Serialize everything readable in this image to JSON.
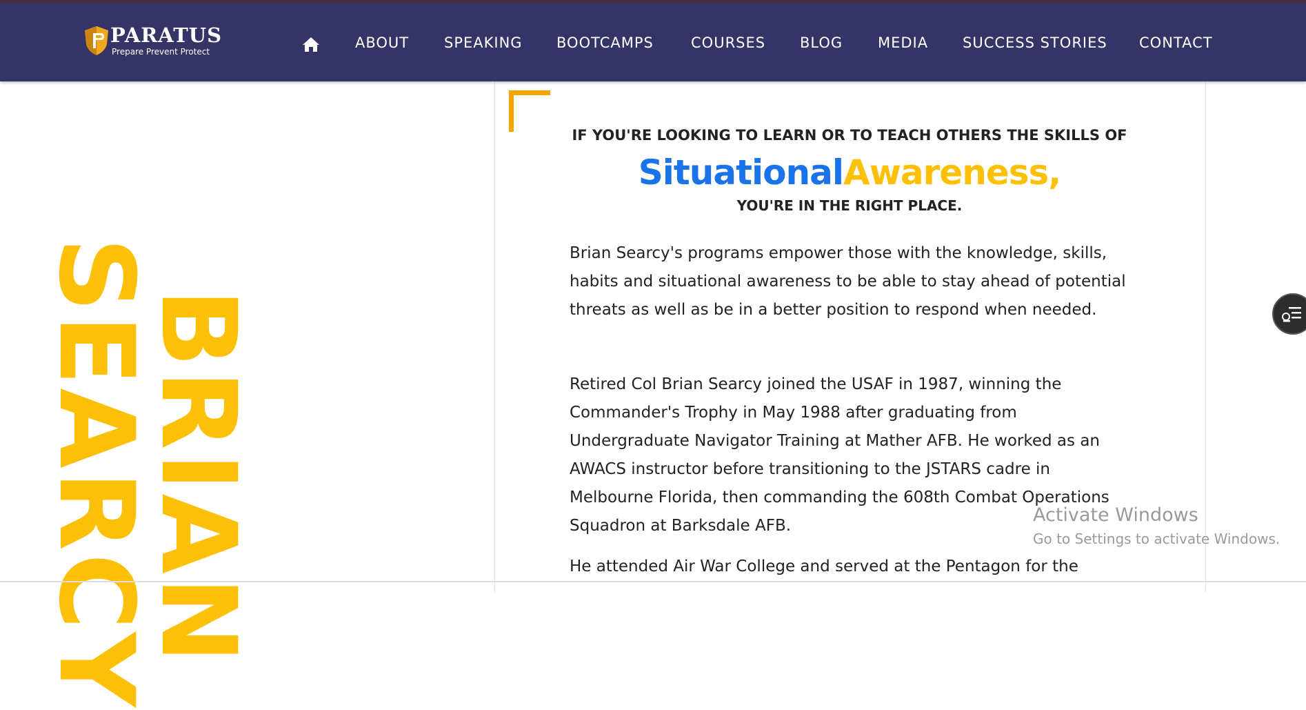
{
  "brand": {
    "name": "PARATUS",
    "tagline": "Prepare Prevent Protect",
    "shield_color": "#f0a91c"
  },
  "header": {
    "background": "#353467",
    "nav": [
      "ABOUT",
      "SPEAKING",
      "BOOTCAMPS",
      "COURSES",
      "BLOG",
      "MEDIA",
      "SUCCESS STORIES",
      "CONTACT"
    ],
    "home_icon": "home-icon"
  },
  "hero": {
    "first_name": "BRIAN",
    "last_name": "SEARCY",
    "accent_color": "#fbc007"
  },
  "intro": {
    "line1": "IF YOU'RE LOOKING TO LEARN OR TO TEACH OTHERS THE SKILLS OF",
    "headline_part1": "Situational",
    "headline_part2": "Awareness,",
    "line3": "YOU'RE IN THE RIGHT PLACE.",
    "blue": "#1a73e8",
    "gold": "#fbc007"
  },
  "body": {
    "p1": "Brian Searcy's programs empower those with the knowledge, skills, habits and situational awareness to be able to stay ahead of potential threats as well as be in a better position to respond when needed.",
    "p2": "Retired Col Brian Searcy joined the USAF in 1987, winning the Commander's Trophy in May 1988 after graduating from Undergraduate Navigator Training at Mather AFB. He worked as an AWACS instructor before transitioning to the JSTARS cadre in Melbourne Florida, then commanding the 608th Combat Operations Squadron at Barksdale AFB.",
    "p3": "He attended Air War College and served at the Pentagon for the"
  },
  "widget": {
    "icon": "accessibility-menu-icon"
  },
  "watermark": {
    "title": "Activate Windows",
    "subtitle": "Go to Settings to activate Windows."
  }
}
